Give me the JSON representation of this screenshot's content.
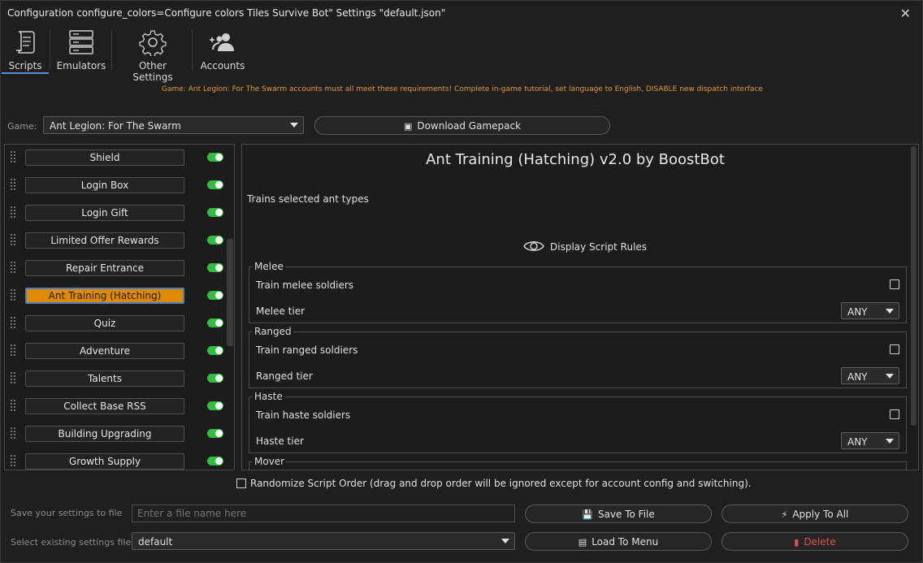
{
  "window": {
    "title": "Configuration configure_colors=Configure colors Tiles Survive Bot\" Settings \"default.json\"",
    "close_glyph": "✕"
  },
  "toolbar": {
    "tabs": [
      {
        "label": "Scripts",
        "icon": "scroll-icon",
        "active": true
      },
      {
        "label": "Emulators",
        "icon": "server-icon",
        "active": false
      },
      {
        "label": "Other Settings",
        "icon": "gear-icon",
        "active": false
      },
      {
        "label": "Accounts",
        "icon": "add-users-icon",
        "active": false
      }
    ]
  },
  "notice": "Game: Ant Legion: For The Swarm accounts must all meet these requirements! Complete in-game tutorial, set language to English, DISABLE new dispatch interface",
  "game": {
    "label": "Game:",
    "selected": "Ant Legion: For The Swarm",
    "download_label": "Download Gamepack",
    "download_icon": "package-icon"
  },
  "scripts": [
    {
      "label": "Shield",
      "enabled": true,
      "selected": false
    },
    {
      "label": "Login Box",
      "enabled": true,
      "selected": false
    },
    {
      "label": "Login Gift",
      "enabled": true,
      "selected": false
    },
    {
      "label": "Limited Offer Rewards",
      "enabled": true,
      "selected": false
    },
    {
      "label": "Repair Entrance",
      "enabled": true,
      "selected": false
    },
    {
      "label": "Ant Training (Hatching)",
      "enabled": true,
      "selected": true
    },
    {
      "label": "Quiz",
      "enabled": true,
      "selected": false
    },
    {
      "label": "Adventure",
      "enabled": true,
      "selected": false
    },
    {
      "label": "Talents",
      "enabled": true,
      "selected": false
    },
    {
      "label": "Collect Base RSS",
      "enabled": true,
      "selected": false
    },
    {
      "label": "Building Upgrading",
      "enabled": true,
      "selected": false
    },
    {
      "label": "Growth Supply",
      "enabled": true,
      "selected": false
    }
  ],
  "detail": {
    "title": "Ant Training (Hatching) v2.0 by BoostBot",
    "description": "Trains selected ant types",
    "rules_label": "Display Script Rules",
    "groups": [
      {
        "name": "Melee",
        "train_label": "Train melee soldiers",
        "train_checked": false,
        "tier_label": "Melee tier",
        "tier_value": "ANY"
      },
      {
        "name": "Ranged",
        "train_label": "Train ranged soldiers",
        "train_checked": false,
        "tier_label": "Ranged tier",
        "tier_value": "ANY"
      },
      {
        "name": "Haste",
        "train_label": "Train haste soldiers",
        "train_checked": false,
        "tier_label": "Haste tier",
        "tier_value": "ANY"
      },
      {
        "name": "Mover"
      }
    ]
  },
  "randomize": {
    "label": "Randomize Script Order (drag and drop order will be ignored except for account config and switching).",
    "checked": false
  },
  "save": {
    "label": "Save your settings to file",
    "placeholder": "Enter a file name here",
    "save_button": "Save To File",
    "apply_button": "Apply To All"
  },
  "load": {
    "label": "Select existing settings file",
    "selected": "default",
    "load_button": "Load To Menu",
    "delete_button": "Delete"
  },
  "colors": {
    "accent": "#e08a00",
    "toggle_on": "#2fbf3f",
    "notice": "#e59a2c",
    "delete": "#e05050",
    "active_tab": "#5a8fd6"
  }
}
